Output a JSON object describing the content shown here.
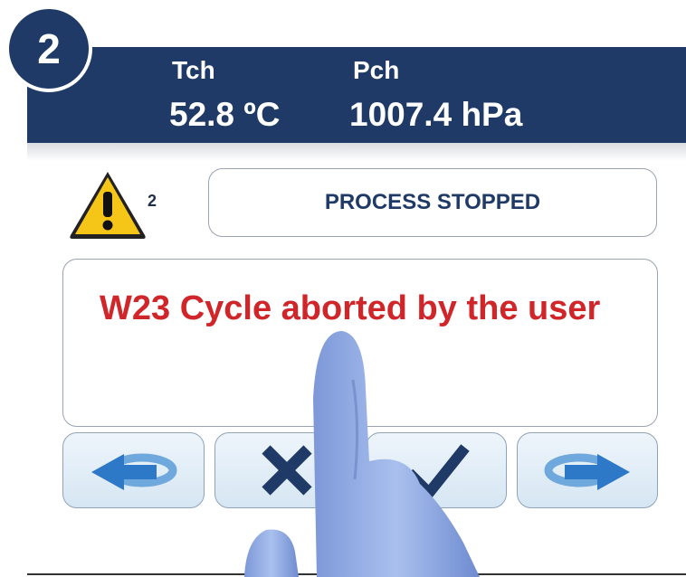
{
  "step_number": "2",
  "readouts": {
    "tch": {
      "label": "Tch",
      "value": "52.8 ºC"
    },
    "pch": {
      "label": "Pch",
      "value": "1007.4 hPa"
    }
  },
  "alarm": {
    "count": "2",
    "icon": "warning-triangle-icon"
  },
  "status": {
    "text": "PROCESS STOPPED"
  },
  "message": {
    "text": "W23 Cycle aborted by the user"
  },
  "buttons": {
    "back": {
      "icon": "back-arrow-icon"
    },
    "cancel": {
      "icon": "cross-icon"
    },
    "confirm": {
      "icon": "check-icon"
    },
    "forward": {
      "icon": "forward-arrow-icon"
    }
  },
  "colors": {
    "header": "#1f3a66",
    "message_text": "#d0262a",
    "status_text": "#1f3a66",
    "warning_yellow": "#f5c518",
    "button_arrow": "#2e78c8"
  }
}
